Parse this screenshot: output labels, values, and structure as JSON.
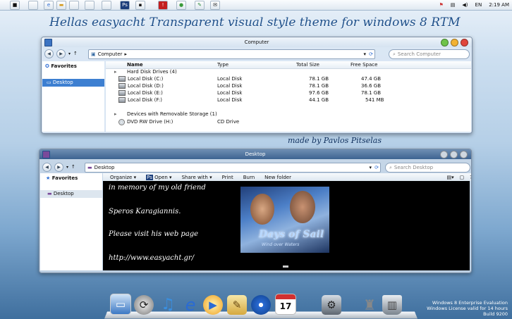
{
  "taskbar": {
    "clock": "2:19 AM",
    "language": "EN",
    "tray_icons": [
      "flag-icon",
      "network-icon",
      "volume-icon"
    ],
    "pinned": [
      "explorer",
      "blank",
      "ie",
      "folder",
      "photoshop",
      "blank",
      "app",
      "blank",
      "stop",
      "chrome",
      "notepad",
      "mail"
    ]
  },
  "banner": {
    "title": "Hellas easyacht  Transparent visual style theme  for windows 8 RTM",
    "byline": "made by Pavlos Pitselas"
  },
  "window1": {
    "title": "Computer",
    "address": "Computer",
    "search_placeholder": "Search Computer",
    "sidebar": [
      {
        "label": "Favorites"
      },
      {
        "label": "Desktop"
      }
    ],
    "columns": [
      "Name",
      "Type",
      "Total Size",
      "Free Space"
    ],
    "group1": "Hard Disk Drives (4)",
    "drives": [
      {
        "name": "Local Disk (C:)",
        "type": "Local Disk",
        "total": "78.1 GB",
        "free": "47.4 GB"
      },
      {
        "name": "Local Disk (D:)",
        "type": "Local Disk",
        "total": "78.1 GB",
        "free": "36.6 GB"
      },
      {
        "name": "Local Disk (E:)",
        "type": "Local Disk",
        "total": "97.6 GB",
        "free": "78.1 GB"
      },
      {
        "name": "Local Disk (F:)",
        "type": "Local Disk",
        "total": "44.1 GB",
        "free": "541 MB"
      }
    ],
    "group2": "Devices with Removable Storage (1)",
    "removable": [
      {
        "name": "DVD RW Drive (H:)",
        "type": "CD Drive"
      }
    ]
  },
  "window2": {
    "title": "Desktop",
    "address": "Desktop",
    "search_placeholder": "Search Desktop",
    "sidebar": [
      {
        "label": "Favorites"
      },
      {
        "label": "Desktop"
      }
    ],
    "commands": [
      "Organize",
      "Open",
      "Share with",
      "Print",
      "Burn",
      "New folder"
    ],
    "lines": [
      "in memory of my old friend",
      "Speros Karagiannis.",
      "Please visit his web page",
      "http://www.easyacht.gr/"
    ],
    "poster": {
      "title": "Days of Sail",
      "subtitle": "Wind over Waters"
    }
  },
  "dock": {
    "icons": [
      "imac-icon",
      "sync-icon",
      "music-note-icon",
      "internet-explorer-icon",
      "media-player-icon",
      "pencil-icon",
      "dvd-icon",
      "calendar-icon",
      "system-preferences-icon",
      "rocket-icon",
      "trash-icon"
    ],
    "calendar_day": "17"
  },
  "watermark": {
    "line1": "Windows 8 Enterprise Evaluation",
    "line2": "Windows License valid for 14 hours",
    "line3": "Build 9200"
  },
  "colors": {
    "accent": "#1d4f8a",
    "selection": "#3d7fd1",
    "title_dark": "#3d6391"
  }
}
